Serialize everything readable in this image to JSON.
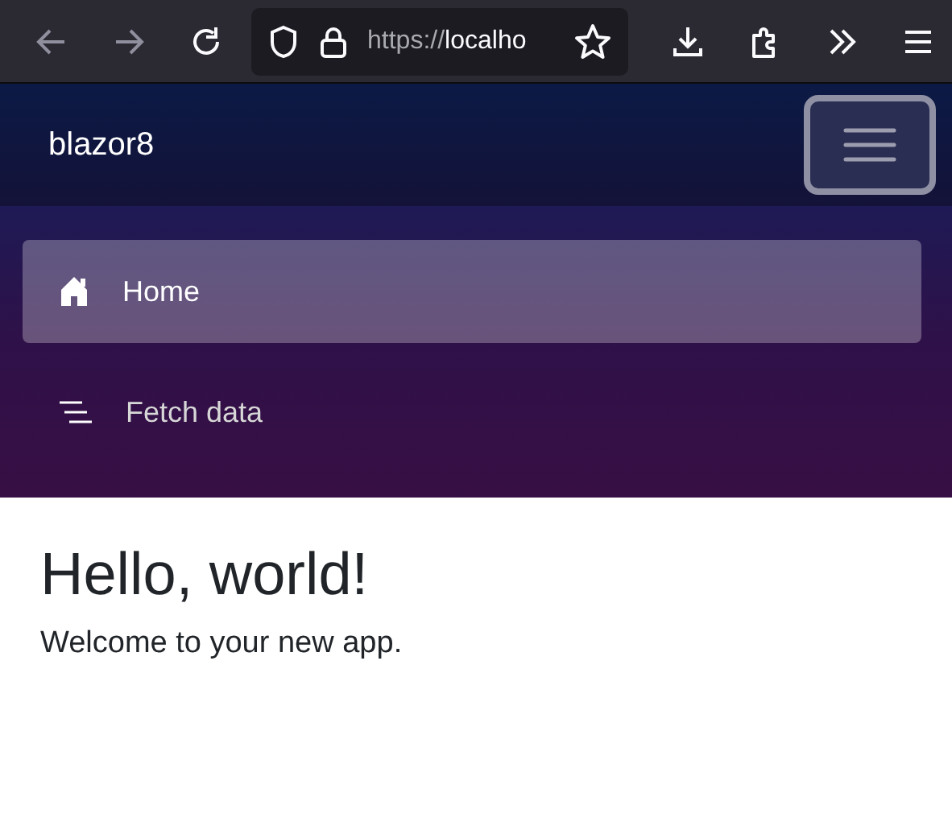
{
  "browser": {
    "nav_buttons": [
      {
        "kind": "back",
        "disabled": true
      },
      {
        "kind": "forward",
        "disabled": true
      },
      {
        "kind": "reload",
        "disabled": false
      }
    ],
    "address_bar": {
      "scheme": "https://",
      "host": "localho"
    }
  },
  "navbar": {
    "brand": "blazor8"
  },
  "nav": {
    "items": [
      {
        "label": "Home",
        "kind": "home",
        "selected": true
      },
      {
        "label": "Fetch data",
        "kind": "list",
        "selected": false
      }
    ]
  },
  "content": {
    "heading": "Hello, world!",
    "text": "Welcome to your new app."
  }
}
